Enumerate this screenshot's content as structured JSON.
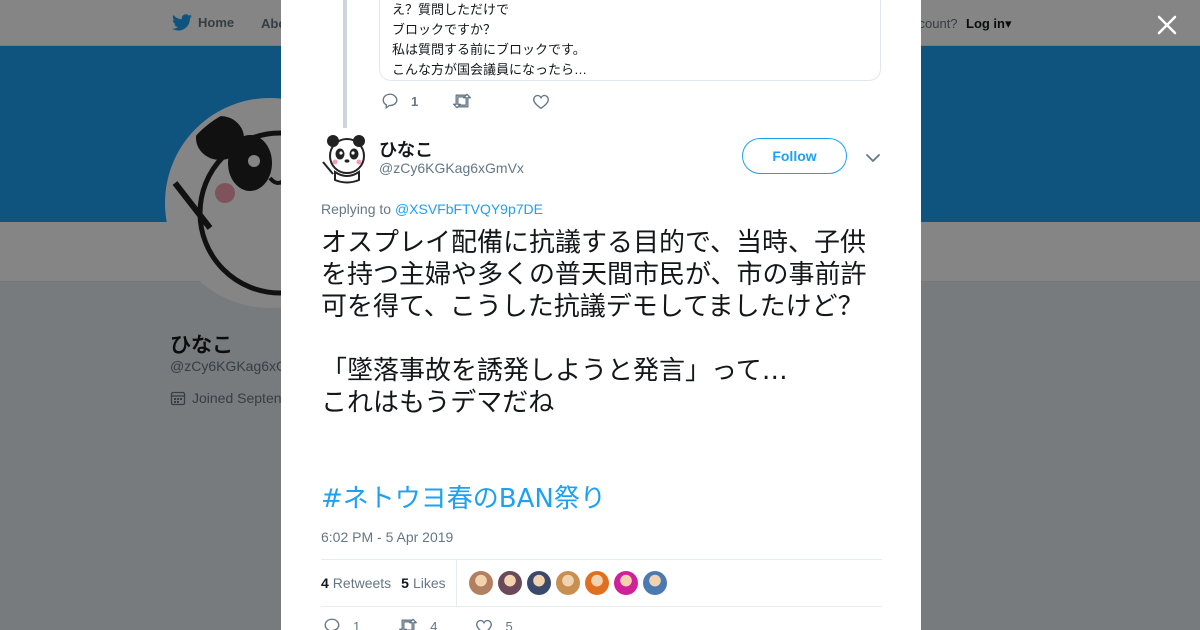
{
  "nav": {
    "home_label": "Home",
    "about_label": "Abo",
    "account_text": "ccount?",
    "login_label": "Log in"
  },
  "profile_bg": {
    "name": "ひなこ",
    "handle": "@zCy6KGKag6xG",
    "joined": "Joined Septen"
  },
  "previous_tweet": {
    "lines": [
      "え？質問しただけで",
      "ブロックですか？",
      "私は質問する前にブロックです。",
      "こんな方が国会議員になったら…"
    ],
    "reply_count": "1",
    "retweet_count": "",
    "like_count": ""
  },
  "tweet": {
    "author_name": "ひなこ",
    "author_handle": "@zCy6KGKag6xGmVx",
    "follow_label": "Follow",
    "replying_prefix": "Replying to",
    "replying_to": "@XSVFbFTVQY9p7DE",
    "text": "オスプレイ配備に抗議する目的で、当時、子供を持つ主婦や多くの普天間市民が、市の事前許可を得て、こうした抗議デモしてましたけど？\n\n「墜落事故を誘発しようと発言」って…\nこれはもうデマだね",
    "hashtag": "#ネトウヨ春のBAN祭り",
    "timestamp": "6:02 PM - 5 Apr 2019",
    "retweets_count": "4",
    "retweets_label": "Retweets",
    "likes_count": "5",
    "likes_label": "Likes",
    "reply_count": "1",
    "retweet_count": "4",
    "like_count": "5"
  },
  "colors": {
    "brand": "#1da1f2",
    "text": "#14171a",
    "muted": "#657786"
  },
  "liker_avatar_colors": [
    "#b08060",
    "#6a4a58",
    "#3a4a6a",
    "#c89050",
    "#e07020",
    "#d0209a",
    "#4a7ab0"
  ]
}
